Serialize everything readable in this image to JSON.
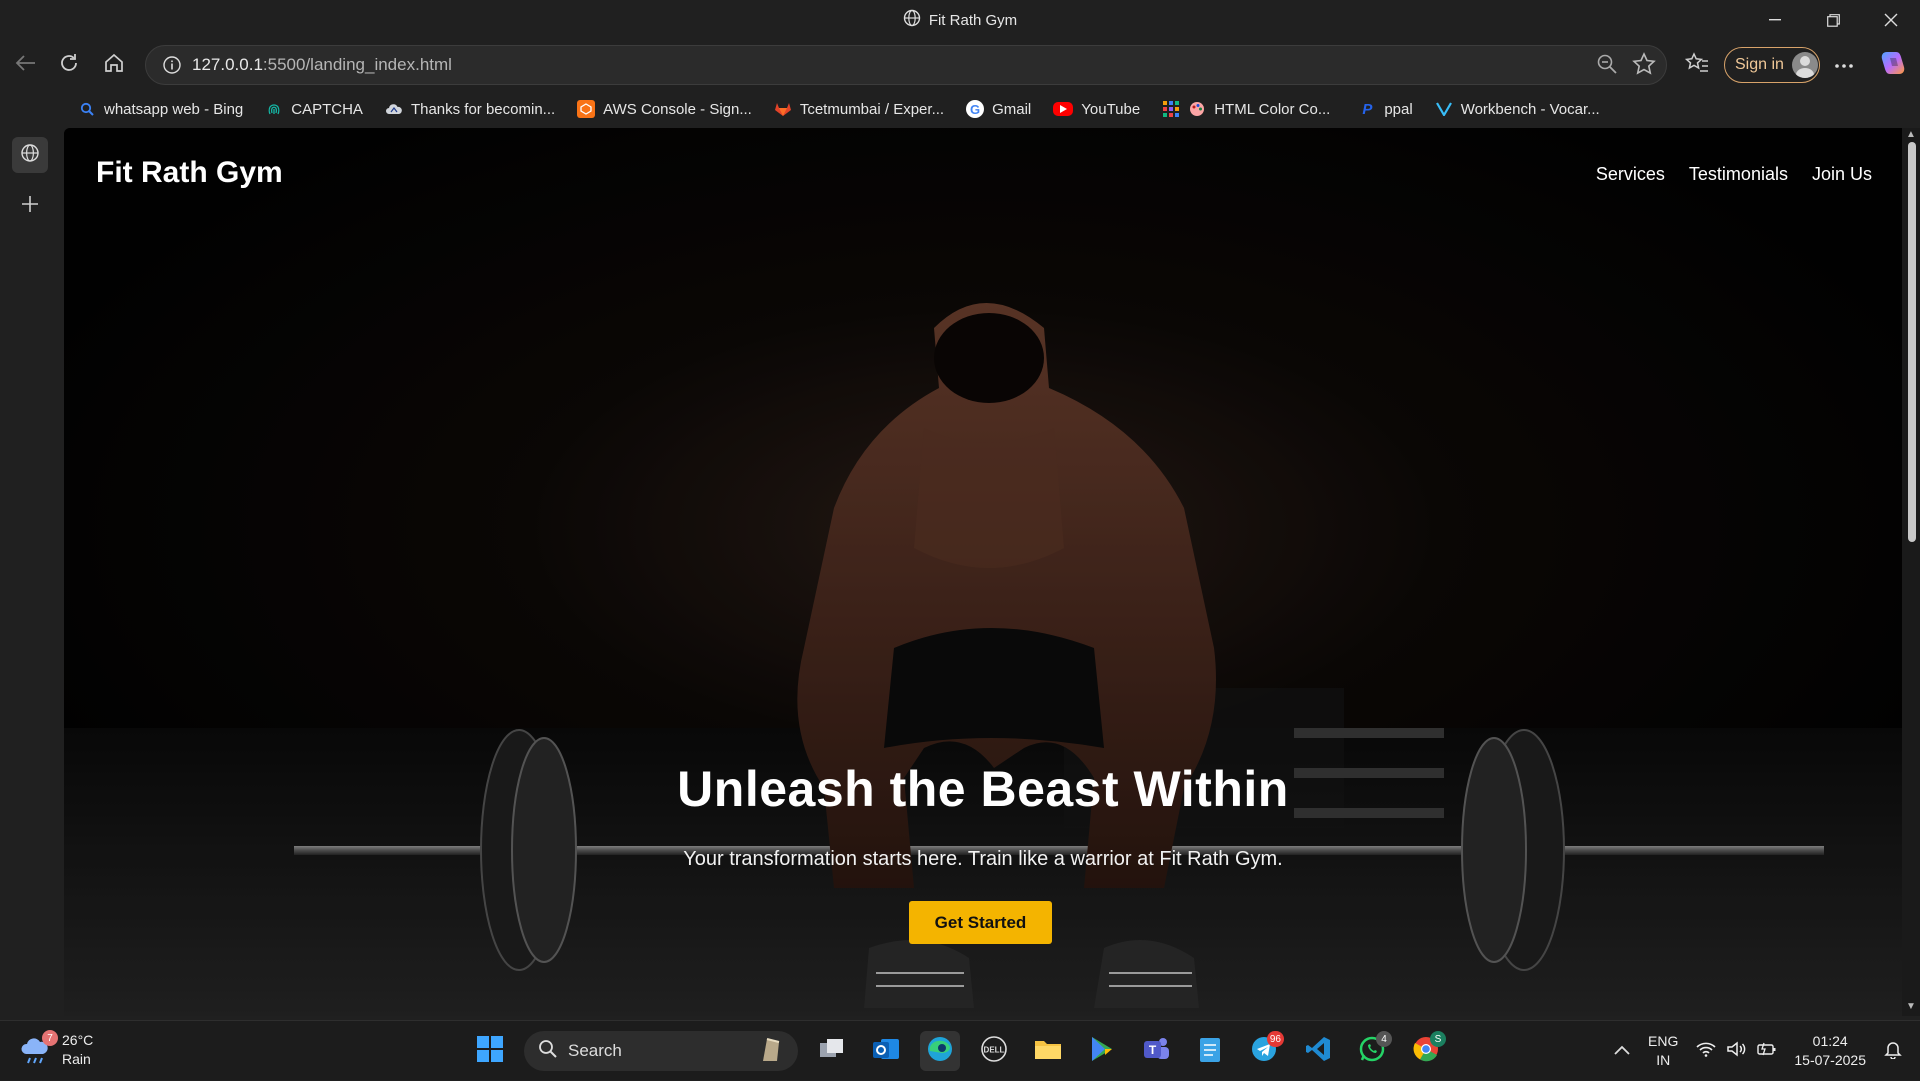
{
  "browser": {
    "window_title": "Fit Rath Gym",
    "url_host": "127.0.0.1",
    "url_rest": ":5500/landing_index.html",
    "signin_label": "Sign in"
  },
  "bookmarks": [
    {
      "label": "whatsapp web - Bing",
      "icon": "search-icon",
      "color": "#3b82f6"
    },
    {
      "label": "CAPTCHA",
      "icon": "fingerprint-icon",
      "color": "#14b8a6"
    },
    {
      "label": "Thanks for becomin...",
      "icon": "cloud-icon",
      "color": "#9ca3af"
    },
    {
      "label": "AWS Console - Sign...",
      "icon": "aws-icon",
      "color": "#f97316"
    },
    {
      "label": "Tcetmumbai / Exper...",
      "icon": "gitlab-icon",
      "color": "#e24329"
    },
    {
      "label": "Gmail",
      "icon": "google-icon",
      "color": "#ffffff"
    },
    {
      "label": "YouTube",
      "icon": "youtube-icon",
      "color": "#ff0000"
    },
    {
      "label": "HTML Color Co...",
      "icon": "palette-icon",
      "color": "#ef4444"
    },
    {
      "label": "ppal",
      "icon": "paypal-icon",
      "color": "#2563eb"
    },
    {
      "label": "Workbench - Vocar...",
      "icon": "vocareum-icon",
      "color": "#38bdf8"
    }
  ],
  "site": {
    "logo": "Fit Rath Gym",
    "nav": [
      "Services",
      "Testimonials",
      "Join Us"
    ],
    "headline": "Unleash the Beast Within",
    "tagline": "Your transformation starts here. Train like a warrior at Fit Rath Gym.",
    "cta": "Get Started",
    "accent": "#f4b400"
  },
  "taskbar": {
    "weather_temp": "26°C",
    "weather_desc": "Rain",
    "weather_badge": "7",
    "search_label": "Search",
    "telegram_badge": "96",
    "whatsapp_badge": "4",
    "chrome_badge": "S",
    "lang_1": "ENG",
    "lang_2": "IN",
    "time": "01:24",
    "date": "15-07-2025"
  }
}
